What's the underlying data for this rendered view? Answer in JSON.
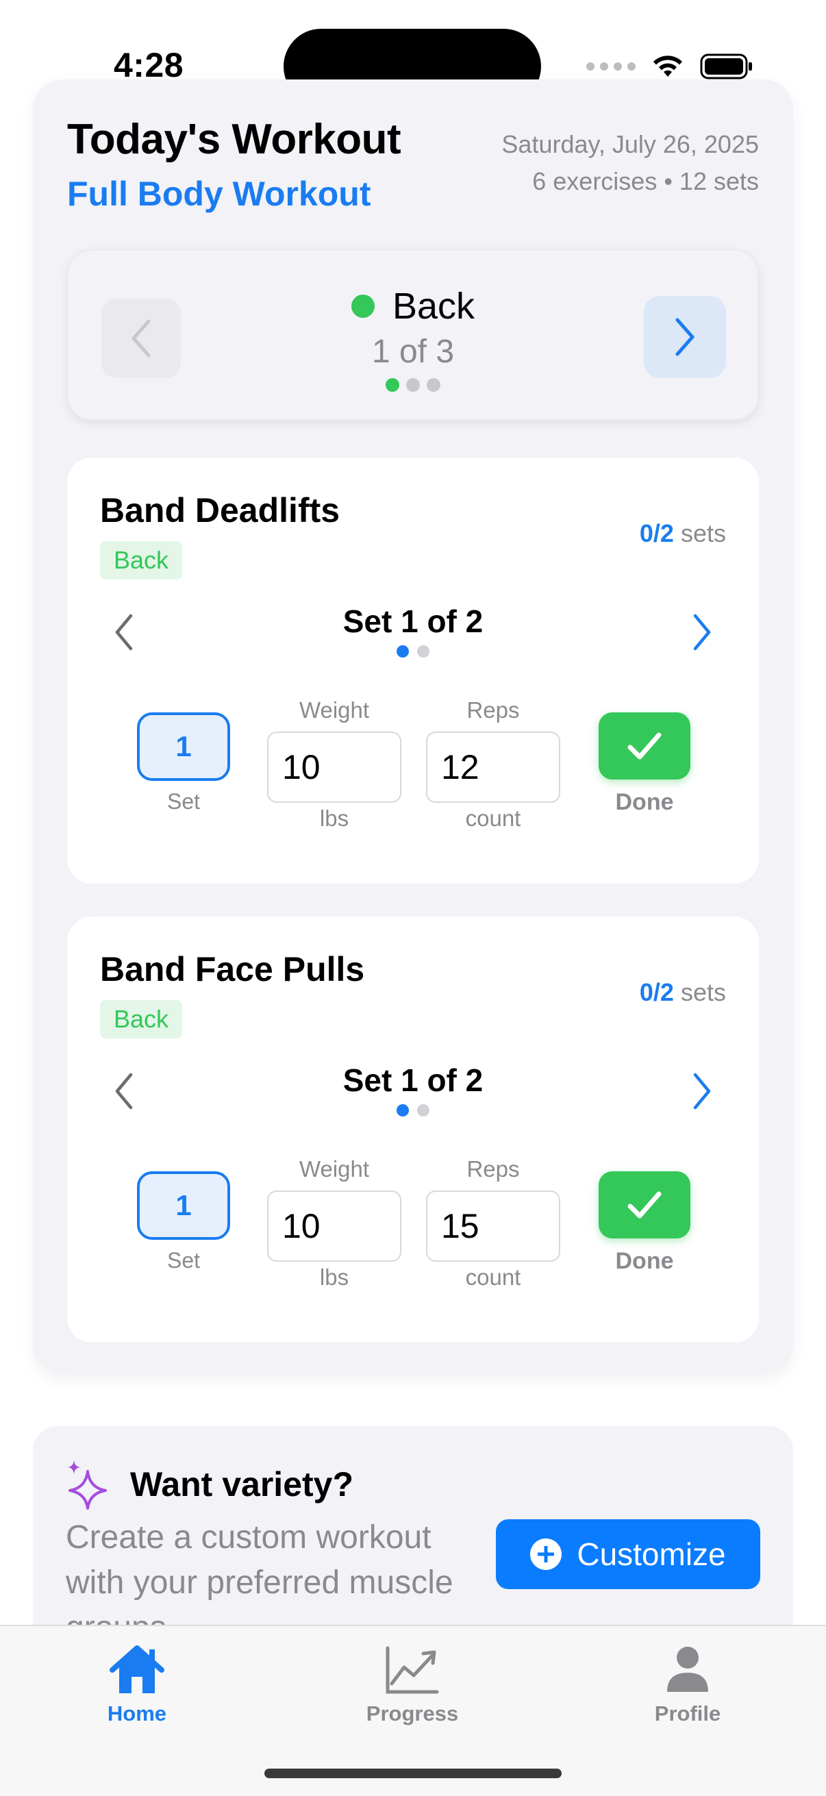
{
  "status_bar": {
    "time": "4:28"
  },
  "header": {
    "title": "Today's Workout",
    "subtitle": "Full Body Workout",
    "date": "Saturday, July 26, 2025",
    "meta": "6 exercises • 12 sets"
  },
  "group_nav": {
    "name": "Back",
    "position": "1 of 3",
    "dot_color": "#34c759",
    "page_count": 3,
    "current_page": 1
  },
  "exercises": [
    {
      "name": "Band Deadlifts",
      "tag": "Back",
      "sets_done": "0/2",
      "sets_label": "sets",
      "set_title": "Set 1 of 2",
      "set_number": "1",
      "set_caption": "Set",
      "weight_label": "Weight",
      "weight_value": "10",
      "weight_unit": "lbs",
      "reps_label": "Reps",
      "reps_value": "12",
      "reps_unit": "count",
      "done_label": "Done"
    },
    {
      "name": "Band Face Pulls",
      "tag": "Back",
      "sets_done": "0/2",
      "sets_label": "sets",
      "set_title": "Set 1 of 2",
      "set_number": "1",
      "set_caption": "Set",
      "weight_label": "Weight",
      "weight_value": "10",
      "weight_unit": "lbs",
      "reps_label": "Reps",
      "reps_value": "15",
      "reps_unit": "count",
      "done_label": "Done"
    }
  ],
  "variety": {
    "title": "Want variety?",
    "description": "Create a custom workout with your preferred muscle groups",
    "button_label": "Customize"
  },
  "tabs": [
    {
      "label": "Home",
      "icon": "house-icon",
      "active": true
    },
    {
      "label": "Progress",
      "icon": "chart-icon",
      "active": false
    },
    {
      "label": "Profile",
      "icon": "person-icon",
      "active": false
    }
  ],
  "colors": {
    "accent": "#1a7cf0",
    "success": "#34c759",
    "muted": "#8a8a8e"
  }
}
